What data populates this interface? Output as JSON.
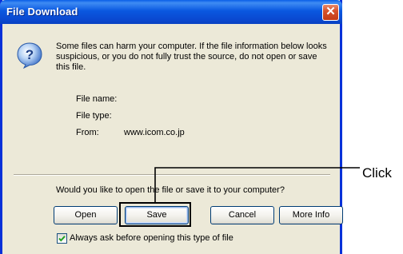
{
  "window": {
    "title": "File Download",
    "close_symbol": "✕",
    "colors": {
      "titlebar": "#0a58e0",
      "frame": "#0831d9",
      "face": "#ece9d8",
      "close": "#d7522c"
    }
  },
  "dialog": {
    "icon": "question-icon",
    "warning": "Some files can harm your computer. If the file information below looks suspicious, or you do not fully trust the source, do not open or save this file.",
    "fields": [
      {
        "label": "File name:",
        "value": ""
      },
      {
        "label": "File type:",
        "value": ""
      },
      {
        "label": "From:",
        "value": "www.icom.co.jp"
      }
    ],
    "question": "Would you like to open the file or save it to your computer?",
    "buttons": {
      "open": "Open",
      "save": "Save",
      "cancel": "Cancel",
      "more_info": "More Info"
    },
    "checkbox": {
      "label": "Always ask before opening this type of file",
      "checked": true
    }
  },
  "annotation": {
    "label": "Click",
    "target": "save-button"
  }
}
